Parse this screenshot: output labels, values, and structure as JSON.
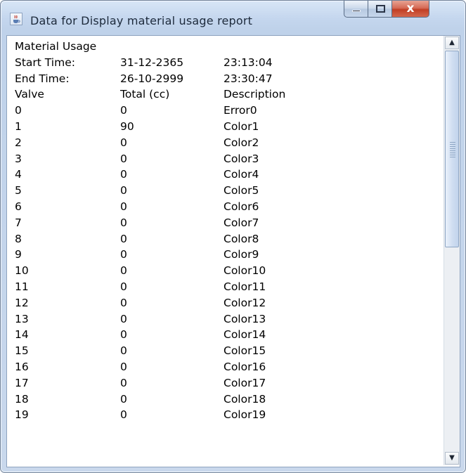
{
  "window": {
    "title": "Data for Display material usage report",
    "icons": {
      "app": "java-cup-icon",
      "minimize": "minimize-icon",
      "maximize": "maximize-icon",
      "close": "close-icon"
    },
    "close_glyph": "x"
  },
  "report": {
    "heading": "Material Usage",
    "start": {
      "label": "Start Time:",
      "date": "31-12-2365",
      "time": "23:13:04"
    },
    "end": {
      "label": "End Time:",
      "date": "26-10-2999",
      "time": "23:30:47"
    },
    "columns": [
      "Valve",
      "Total (cc)",
      "Description"
    ],
    "rows": [
      [
        "0",
        "0",
        "Error0"
      ],
      [
        "1",
        "90",
        "Color1"
      ],
      [
        "2",
        "0",
        "Color2"
      ],
      [
        "3",
        "0",
        "Color3"
      ],
      [
        "4",
        "0",
        "Color4"
      ],
      [
        "5",
        "0",
        "Color5"
      ],
      [
        "6",
        "0",
        "Color6"
      ],
      [
        "7",
        "0",
        "Color7"
      ],
      [
        "8",
        "0",
        "Color8"
      ],
      [
        "9",
        "0",
        "Color9"
      ],
      [
        "10",
        "0",
        "Color10"
      ],
      [
        "11",
        "0",
        "Color11"
      ],
      [
        "12",
        "0",
        "Color12"
      ],
      [
        "13",
        "0",
        "Color13"
      ],
      [
        "14",
        "0",
        "Color14"
      ],
      [
        "15",
        "0",
        "Color15"
      ],
      [
        "16",
        "0",
        "Color16"
      ],
      [
        "17",
        "0",
        "Color17"
      ],
      [
        "18",
        "0",
        "Color18"
      ],
      [
        "19",
        "0",
        "Color19"
      ]
    ]
  },
  "scrollbar": {
    "up_icon": "arrow-up-icon",
    "down_icon": "arrow-down-icon",
    "thumb_fraction": 0.46,
    "position": 0
  }
}
